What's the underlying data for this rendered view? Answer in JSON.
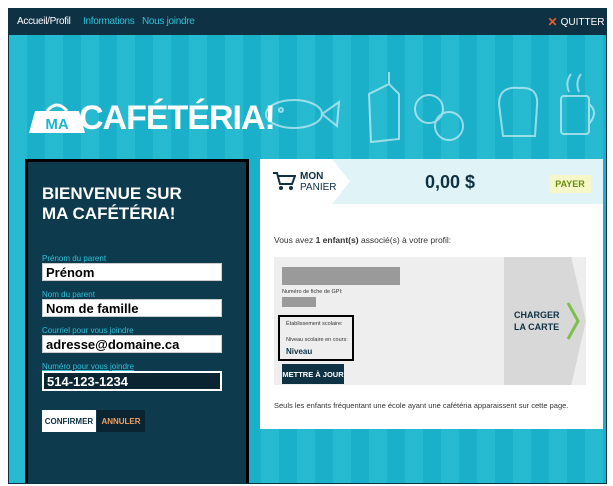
{
  "nav": {
    "items": [
      {
        "label": "Accueil/Profil"
      },
      {
        "label": "Informations"
      },
      {
        "label": "Nous joindre"
      }
    ],
    "quit_label": "QUITTER"
  },
  "logo": {
    "badge_text": "MA",
    "text": "CAFÉTÉRIA!"
  },
  "login": {
    "title_line1": "BIENVENUE SUR",
    "title_line2": "MA CAFÉTÉRIA!",
    "fields": [
      {
        "label": "Prénom du parent",
        "value": "Prénom"
      },
      {
        "label": "Nom du parent",
        "value": "Nom de famille"
      },
      {
        "label": "Courriel pour vous joindre",
        "value": "adresse@domaine.ca"
      },
      {
        "label": "Numéro pour vous joindre",
        "value": "514-123-1234"
      }
    ],
    "confirm_label": "CONFIRMER",
    "cancel_label": "ANNULER"
  },
  "cart": {
    "panier_line1": "MON",
    "panier_line2": "PANIER",
    "total": "0,00 $",
    "pay_label": "PAYER",
    "children_text_pre": "Vous avez ",
    "children_count": "1 enfant(s)",
    "children_text_post": " associé(s) à votre profil:",
    "child": {
      "gpi_label": "Numéro de fiche de GPI:",
      "school_label": "Établissement scolaire:",
      "level_label": "Niveau scolaire en cours:",
      "level_value": "Niveau",
      "update_label": "METTRE À JOUR",
      "charge_line1": "CHARGER",
      "charge_line2": "LA CARTE"
    },
    "footnote": "Seuls les enfants fréquentant une école ayant une cafétéria apparaissent sur cette page."
  },
  "colors": {
    "background": "#1bb6cf",
    "dark_navy": "#0e3143",
    "pay_green": "#6a8c10",
    "quit_x": "#f05a28"
  }
}
